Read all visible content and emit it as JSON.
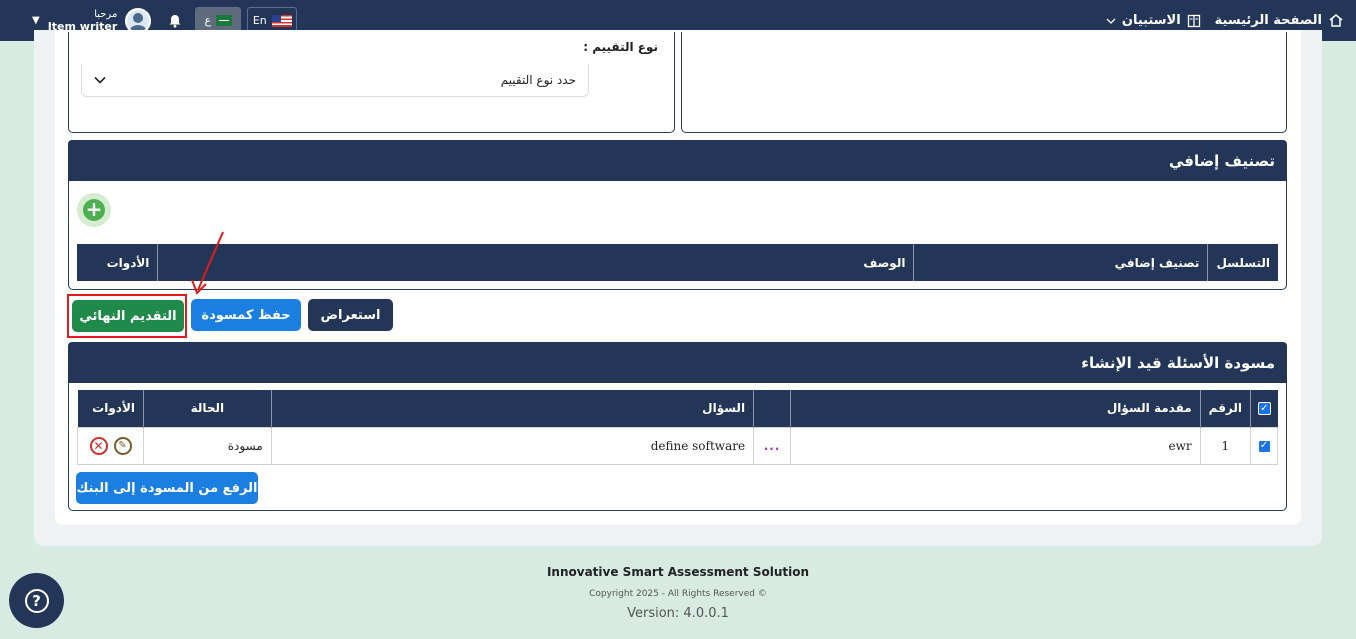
{
  "navbar": {
    "home_label": "الصفحة الرئيسية",
    "survey_label": "الاستبيان",
    "user_greeting": "مرحبا",
    "user_name": "Item writer",
    "lang_ar": "ع",
    "lang_en": "En"
  },
  "evaluation": {
    "type_label": "نوع التقييم :",
    "type_placeholder": "حدد نوع التقييم"
  },
  "extra_classification": {
    "title": "تصنيف إضافي",
    "headers": [
      "التسلسل",
      "تصنيف إضافي",
      "الوصف",
      "الأدوات"
    ]
  },
  "actions": {
    "preview": "استعراض",
    "save_draft": "حفظ كمسودة",
    "final_submit": "التقديم النهائي"
  },
  "drafts": {
    "title": "مسودة الأسئلة قيد الإنشاء",
    "headers": [
      "الرقم",
      "مقدمة السؤال",
      "",
      "السؤال",
      "الحالة",
      "الأدوات"
    ],
    "rows": [
      {
        "number": "1",
        "intro": "ewr",
        "more": "...",
        "question": "define software",
        "status": "مسودة"
      }
    ],
    "upload_button": "الرفع من المسودة إلى البنك"
  },
  "footer": {
    "title": "Innovative Smart Assessment Solution",
    "copyright": "Copyright 2025 - All Rights Reserved ©",
    "version": "Version: 4.0.0.1"
  },
  "colors": {
    "navy": "#243658",
    "blue": "#1a7fe0",
    "green": "#1f8a4a",
    "highlight_red": "#e01b1b"
  }
}
